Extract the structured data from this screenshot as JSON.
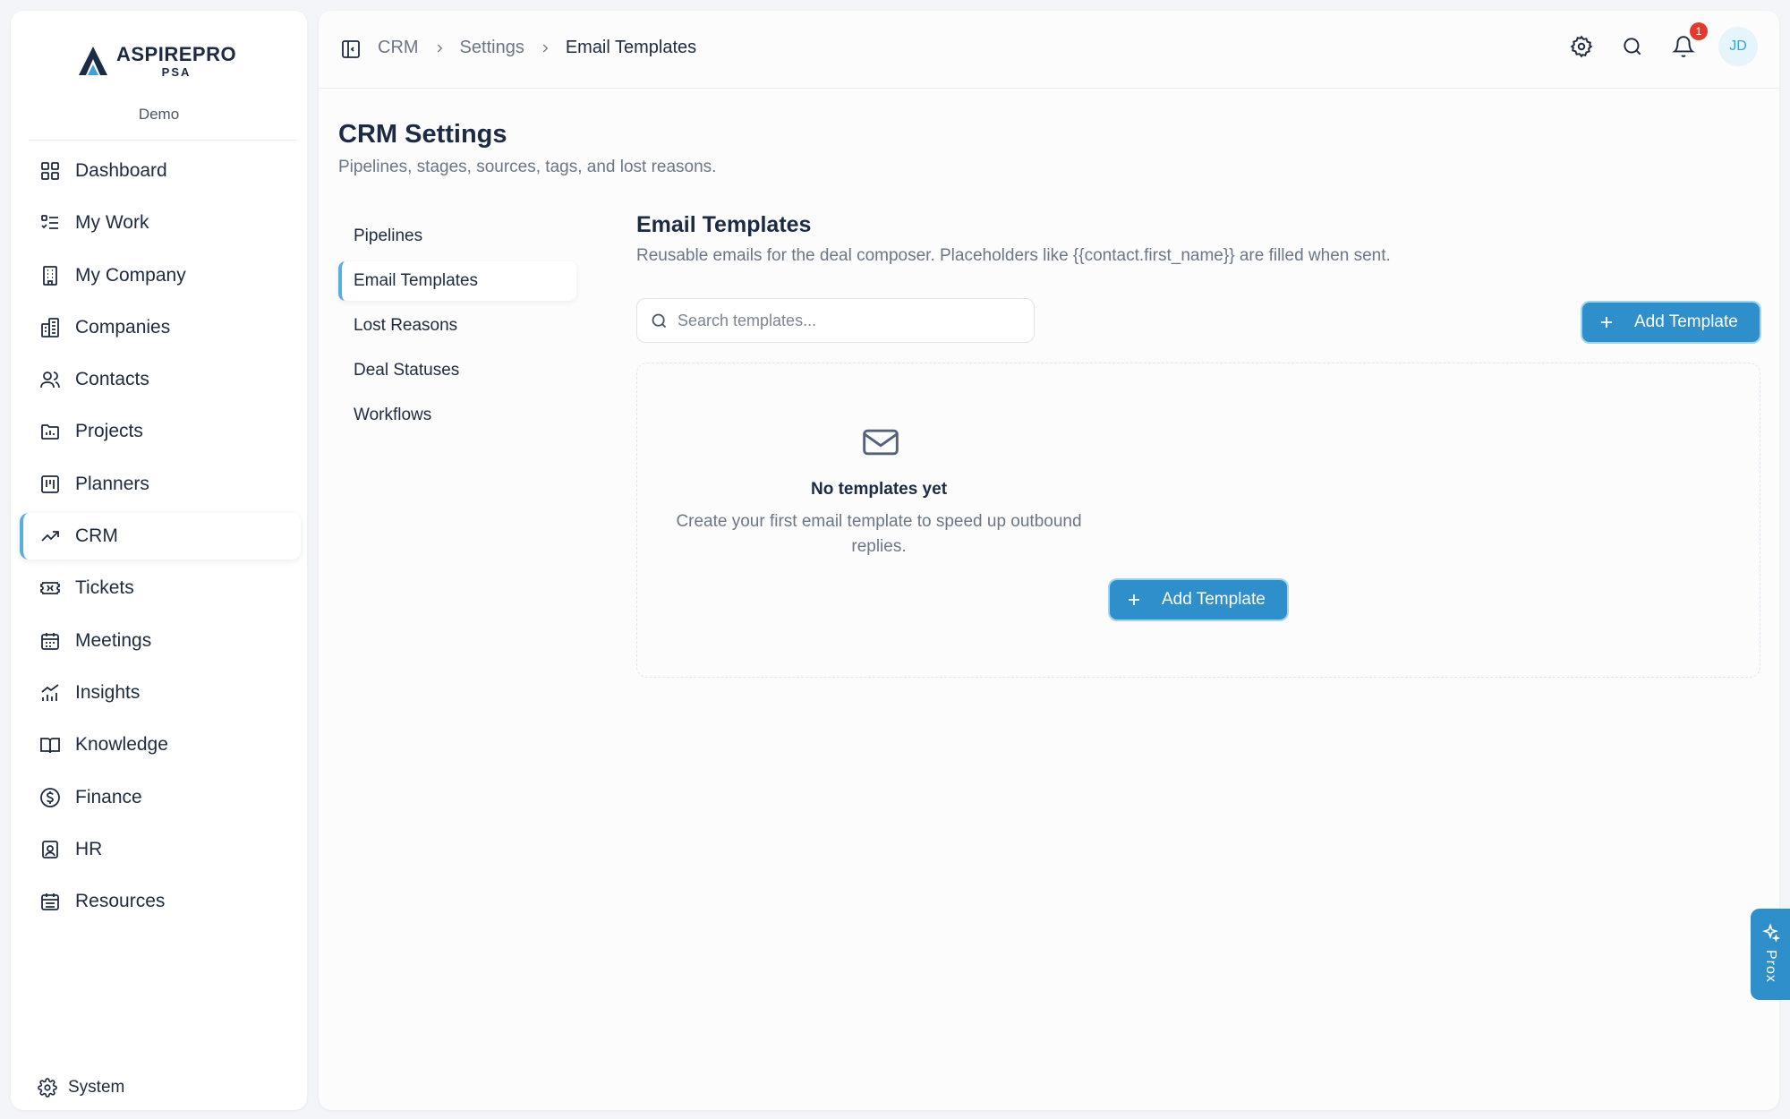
{
  "app": {
    "logo_main": "ASPIREPRO",
    "logo_sub": "PSA",
    "org": "Demo"
  },
  "sidebar": {
    "items": [
      {
        "label": "Dashboard",
        "icon": "dashboard-icon"
      },
      {
        "label": "My Work",
        "icon": "list-check-icon"
      },
      {
        "label": "My Company",
        "icon": "building-icon"
      },
      {
        "label": "Companies",
        "icon": "buildings-icon"
      },
      {
        "label": "Contacts",
        "icon": "users-icon"
      },
      {
        "label": "Projects",
        "icon": "folder-chart-icon"
      },
      {
        "label": "Planners",
        "icon": "kanban-icon"
      },
      {
        "label": "CRM",
        "icon": "trending-up-icon",
        "active": true
      },
      {
        "label": "Tickets",
        "icon": "ticket-icon"
      },
      {
        "label": "Meetings",
        "icon": "calendar-icon"
      },
      {
        "label": "Insights",
        "icon": "bar-chart-icon"
      },
      {
        "label": "Knowledge",
        "icon": "book-icon"
      },
      {
        "label": "Finance",
        "icon": "dollar-icon"
      },
      {
        "label": "HR",
        "icon": "id-badge-icon"
      },
      {
        "label": "Resources",
        "icon": "calendar-grid-icon"
      }
    ],
    "system_label": "System"
  },
  "topbar": {
    "breadcrumbs": [
      "CRM",
      "Settings",
      "Email Templates"
    ],
    "notification_count": "1",
    "avatar_initials": "JD"
  },
  "page": {
    "title": "CRM Settings",
    "subtitle": "Pipelines, stages, sources, tags, and lost reasons."
  },
  "subnav": {
    "items": [
      "Pipelines",
      "Email Templates",
      "Lost Reasons",
      "Deal Statuses",
      "Workflows"
    ],
    "active": "Email Templates"
  },
  "section": {
    "title": "Email Templates",
    "subtitle": "Reusable emails for the deal composer. Placeholders like {{contact.first_name}} are filled when sent.",
    "search_placeholder": "Search templates...",
    "add_button": "Add Template"
  },
  "empty_state": {
    "title": "No templates yet",
    "description": "Create your first email template to speed up outbound replies.",
    "button": "Add Template"
  },
  "prox": {
    "label": "Prox"
  },
  "colors": {
    "accent": "#2f8fcb",
    "active_border": "#5aaedb",
    "badge": "#e23b2e"
  }
}
